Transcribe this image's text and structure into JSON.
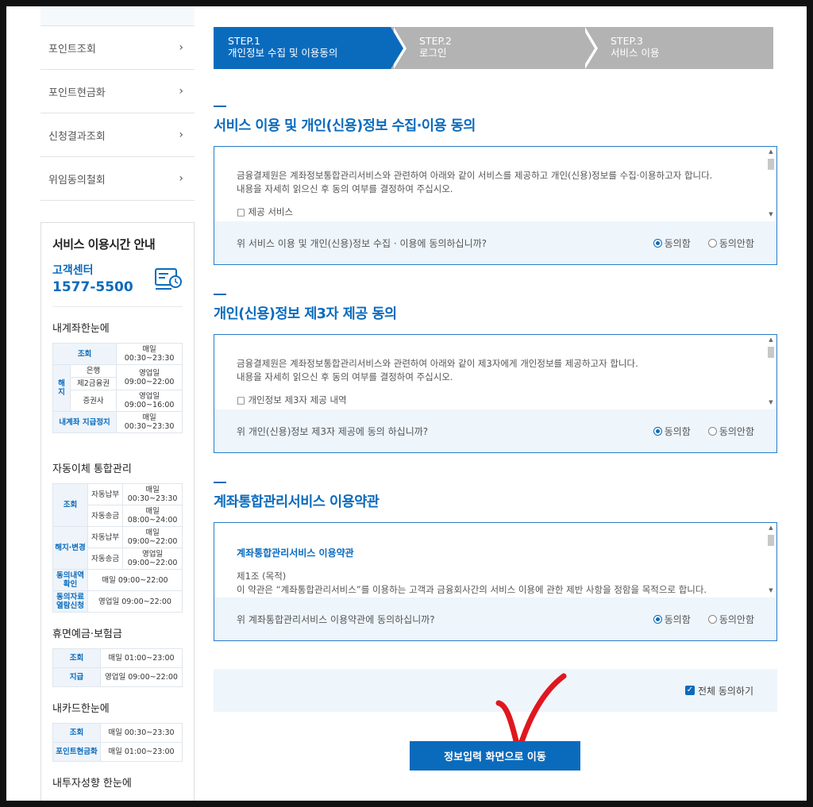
{
  "sidebar": {
    "items": [
      {
        "label": "포인트조회"
      },
      {
        "label": "포인트현금화"
      },
      {
        "label": "신청결과조회"
      },
      {
        "label": "위임동의철회"
      }
    ],
    "hours_title": "서비스 이용시간 안내",
    "cc_label": "고객센터",
    "cc_number": "1577-5500",
    "sec1_title": "내계좌한눈에",
    "sec2_title": "자동이체 통합관리",
    "sec3_title": "휴면예금·보험금",
    "sec4_title": "내카드한눈에",
    "sec5_title": "내투자성향 한눈에",
    "t1": {
      "lookup": "조회",
      "lookup_time": "매일\n00:30~23:30",
      "cancel": "해지",
      "bank": "은행",
      "bank_time": "영업일\n09:00~22:00",
      "fin2": "제2금융권",
      "sec": "증권사",
      "sec_time": "영업일\n09:00~16:00",
      "stop": "내계좌 지급정지",
      "stop_time": "매일\n00:30~23:30"
    },
    "t2": {
      "lookup": "조회",
      "autopay": "자동납부",
      "autopay_time": "매일\n00:30~23:30",
      "autosend": "자동송금",
      "autosend_time": "매일\n08:00~24:00",
      "cancel": "해지·변경",
      "c_autopay": "자동납부",
      "c_autopay_time": "매일\n09:00~22:00",
      "c_autosend": "자동송금",
      "c_autosend_time": "영업일\n09:00~22:00",
      "agree": "동의내역\n확인",
      "agree_time": "매일 09:00~22:00",
      "data": "동의자료\n열람신청",
      "data_time": "영업일 09:00~22:00"
    },
    "t3": {
      "lookup": "조회",
      "lookup_time": "매일 01:00~23:00",
      "pay": "지급",
      "pay_time": "영업일 09:00~22:00"
    },
    "t4": {
      "lookup": "조회",
      "lookup_time": "매일 00:30~23:30",
      "cash": "포인트현금화",
      "cash_time": "매일 01:00~23:00"
    }
  },
  "steps": [
    {
      "num": "STEP.1",
      "label": "개인정보 수집 및 이용동의"
    },
    {
      "num": "STEP.2",
      "label": "로그인"
    },
    {
      "num": "STEP.3",
      "label": "서비스 이용"
    }
  ],
  "sections": [
    {
      "title": "서비스 이용 및 개인(신용)정보 수집·이용 동의",
      "line1": "금융결제원은 계좌정보통합관리서비스와 관련하여 아래와 같이 서비스를 제공하고 개인(신용)정보를 수집·이용하고자 합니다.",
      "line2": "내용을 자세히 읽으신 후 동의 여부를 결정하여 주십시오.",
      "line3": "□ 제공 서비스",
      "question": "위 서비스 이용 및 개인(신용)정보 수집 · 이용에 동의하십니까?"
    },
    {
      "title": "개인(신용)정보 제3자 제공 동의",
      "line1": "금융결제원은 계좌정보통합관리서비스와 관련하여 아래와 같이 제3자에게 개인정보를 제공하고자 합니다.",
      "line2": "내용을 자세히 읽으신 후 동의 여부를 결정하여 주십시오.",
      "line3": "□ 개인정보 제3자 제공 내역",
      "question": "위 개인(신용)정보 제3자 제공에 동의 하십니까?"
    },
    {
      "title": "계좌통합관리서비스 이용약관",
      "term_title": "계좌통합관리서비스 이용약관",
      "line1": "제1조 (목적)",
      "line2": "이 약관은 “계좌통합관리서비스”를 이용하는 고객과 금융회사간의 서비스 이용에 관한 제반 사항을 정함을 목적으로 합니다.",
      "question": "위 계좌통합관리서비스 이용약관에 동의하십니까?"
    }
  ],
  "radio": {
    "agree": "동의함",
    "disagree": "동의안함"
  },
  "agree_all": "전체 동의하기",
  "submit": "정보입력 화면으로 이동",
  "colors": {
    "accent": "#0a6bbd",
    "step_inactive": "#b3b3b3",
    "check": "#e0171f"
  }
}
